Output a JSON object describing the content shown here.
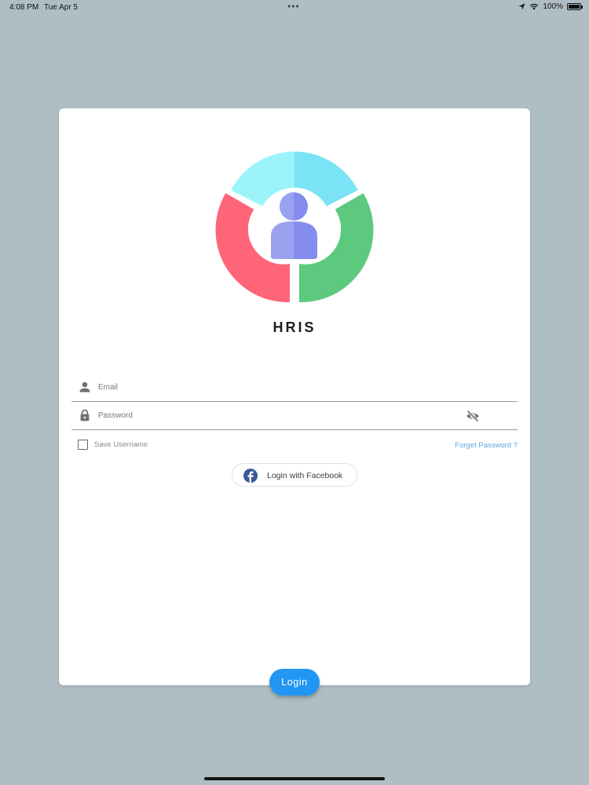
{
  "status_bar": {
    "time": "4:08 PM",
    "date": "Tue Apr 5",
    "dots": "•••",
    "battery": "100%"
  },
  "app": {
    "title": "HRIS"
  },
  "form": {
    "email_placeholder": "Email",
    "email_value": "",
    "password_placeholder": "Password",
    "password_value": "",
    "save_username_label": "Save Username",
    "save_username_checked": false,
    "forget_password_label": "Forget Password ?"
  },
  "social": {
    "facebook_label": "Login with Facebook"
  },
  "actions": {
    "login_label": "Login"
  },
  "colors": {
    "background": "#afbec4",
    "card": "#ffffff",
    "accent": "#2196f3",
    "link": "#5fa6e3",
    "logo_cyan_light": "#9cf4fb",
    "logo_cyan": "#7ae3f5",
    "logo_red": "#fe6578",
    "logo_green": "#5dc97e",
    "logo_person": "#7c84e8",
    "facebook": "#3b5998"
  },
  "icons": {
    "email": "person-icon",
    "password": "lock-icon",
    "visibility": "eye-off-icon",
    "facebook": "facebook-icon",
    "location": "location-arrow-icon",
    "wifi": "wifi-icon",
    "battery": "battery-icon"
  }
}
